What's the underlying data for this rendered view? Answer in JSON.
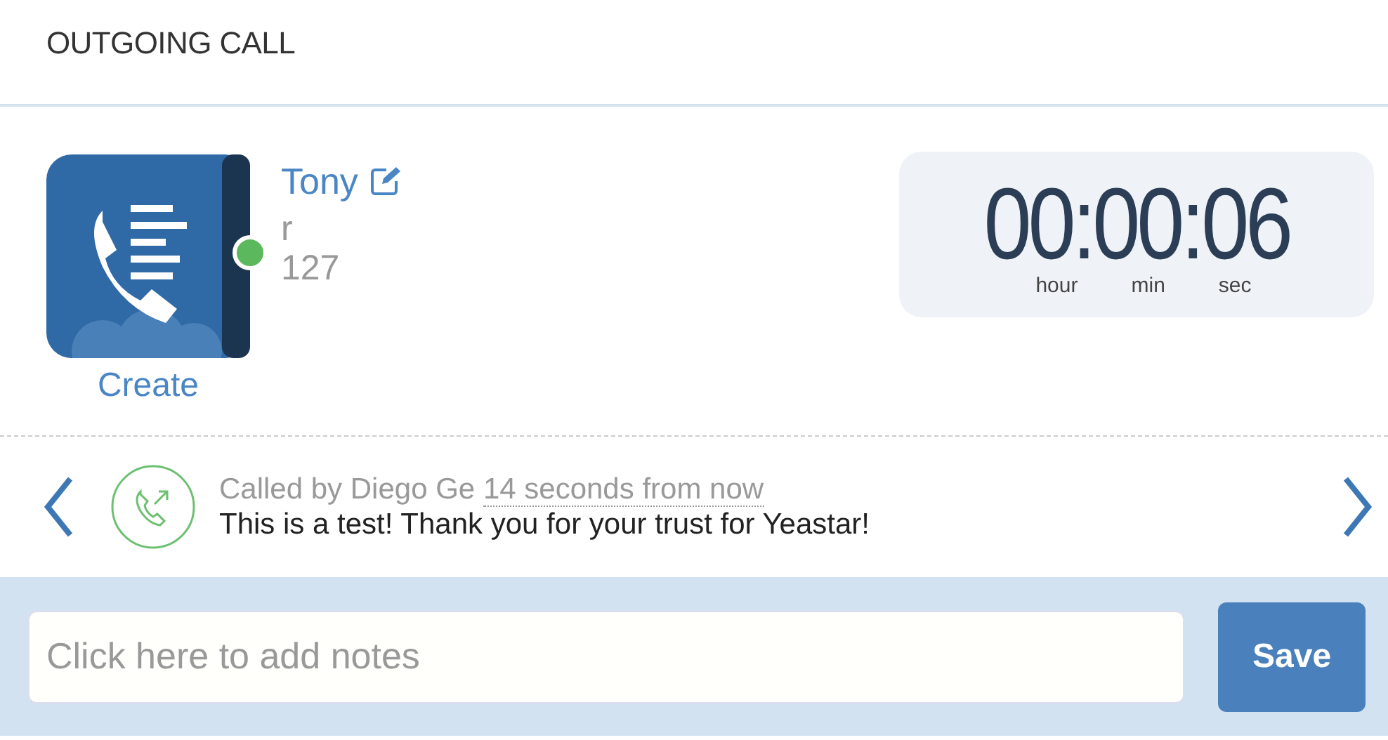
{
  "title": "OUTGOING CALL",
  "contact": {
    "name": "Tony",
    "line": "r",
    "number": "127",
    "online": true,
    "create_label": "Create"
  },
  "timer": {
    "value": "00:00:06",
    "units": [
      "hour",
      "min",
      "sec"
    ]
  },
  "log": {
    "caller": "Called by Diego Ge",
    "time": "14 seconds from now",
    "message": "This is a test! Thank you for your trust for Yeastar!"
  },
  "notes": {
    "placeholder": "Click here to add notes",
    "button": "Save"
  }
}
